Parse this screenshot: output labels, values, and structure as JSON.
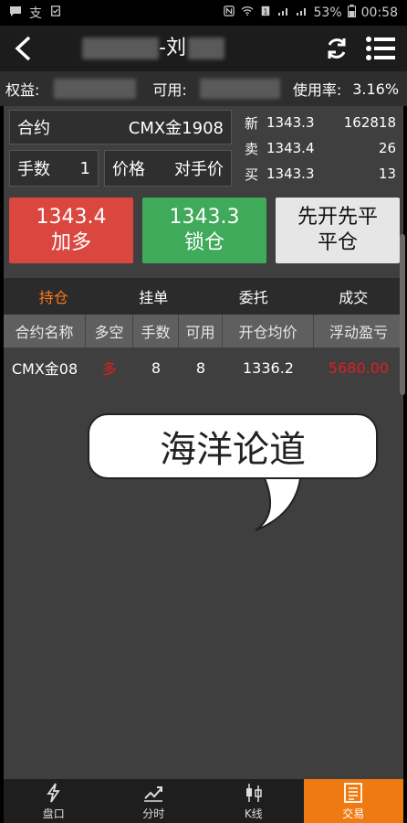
{
  "status_bar": {
    "battery": "53%",
    "time": "00:58",
    "zhi_label": "支"
  },
  "header": {
    "title_suffix": "-刘"
  },
  "equity": {
    "equity_label": "权益:",
    "available_label": "可用:",
    "usage_label": "使用率:",
    "usage_value": "3.16%"
  },
  "order_form": {
    "contract_label": "合约",
    "contract_value": "CMX金1908",
    "lots_label": "手数",
    "lots_value": "1",
    "price_label": "价格",
    "price_value": "对手价"
  },
  "quote": [
    {
      "label": "新",
      "price": "1343.3",
      "volume": "162818"
    },
    {
      "label": "卖",
      "price": "1343.4",
      "volume": "26"
    },
    {
      "label": "买",
      "price": "1343.3",
      "volume": "13"
    }
  ],
  "buttons": {
    "buy": {
      "price": "1343.4",
      "label": "加多"
    },
    "lock": {
      "price": "1343.3",
      "label": "锁仓"
    },
    "close": {
      "line1": "先开先平",
      "line2": "平仓"
    }
  },
  "tabs": [
    "持仓",
    "挂单",
    "委托",
    "成交"
  ],
  "table": {
    "headers": [
      "合约名称",
      "多空",
      "手数",
      "可用",
      "开仓均价",
      "浮动盈亏"
    ],
    "rows": [
      {
        "name": "CMX金08",
        "direction": "多",
        "lots": "8",
        "available": "8",
        "avg_price": "1336.2",
        "pnl": "5680.00"
      }
    ]
  },
  "bubble_text": "海洋论道",
  "bottom_nav": [
    "盘口",
    "分时",
    "K线",
    "交易"
  ],
  "colors": {
    "buy": "#d9473f",
    "lock": "#3faa5a",
    "close": "#e6e6e6",
    "accent": "#f07a12",
    "loss_red": "#e01e1e"
  }
}
